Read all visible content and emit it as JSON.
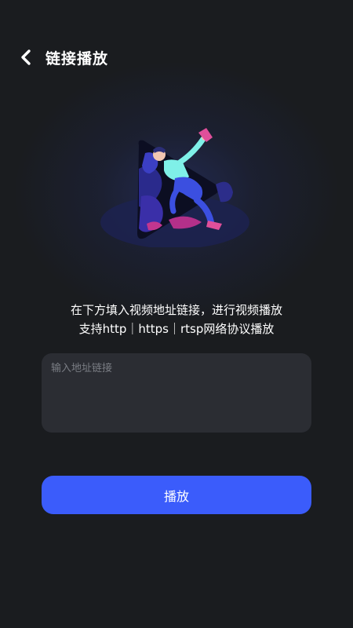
{
  "header": {
    "back_icon": "chevron-left-icon",
    "title": "链接播放"
  },
  "illustration": {
    "icon": "play-person-illustration"
  },
  "hint": {
    "line1": "在下方填入视频地址链接，进行视频播放",
    "line2": "支持http｜https｜rtsp网络协议播放"
  },
  "url_input": {
    "value": "",
    "placeholder": "输入地址链接"
  },
  "play_button": {
    "label": "播放"
  },
  "colors": {
    "background": "#1a1c1f",
    "input_background": "#2b2d33",
    "accent": "#3b5cfb"
  }
}
